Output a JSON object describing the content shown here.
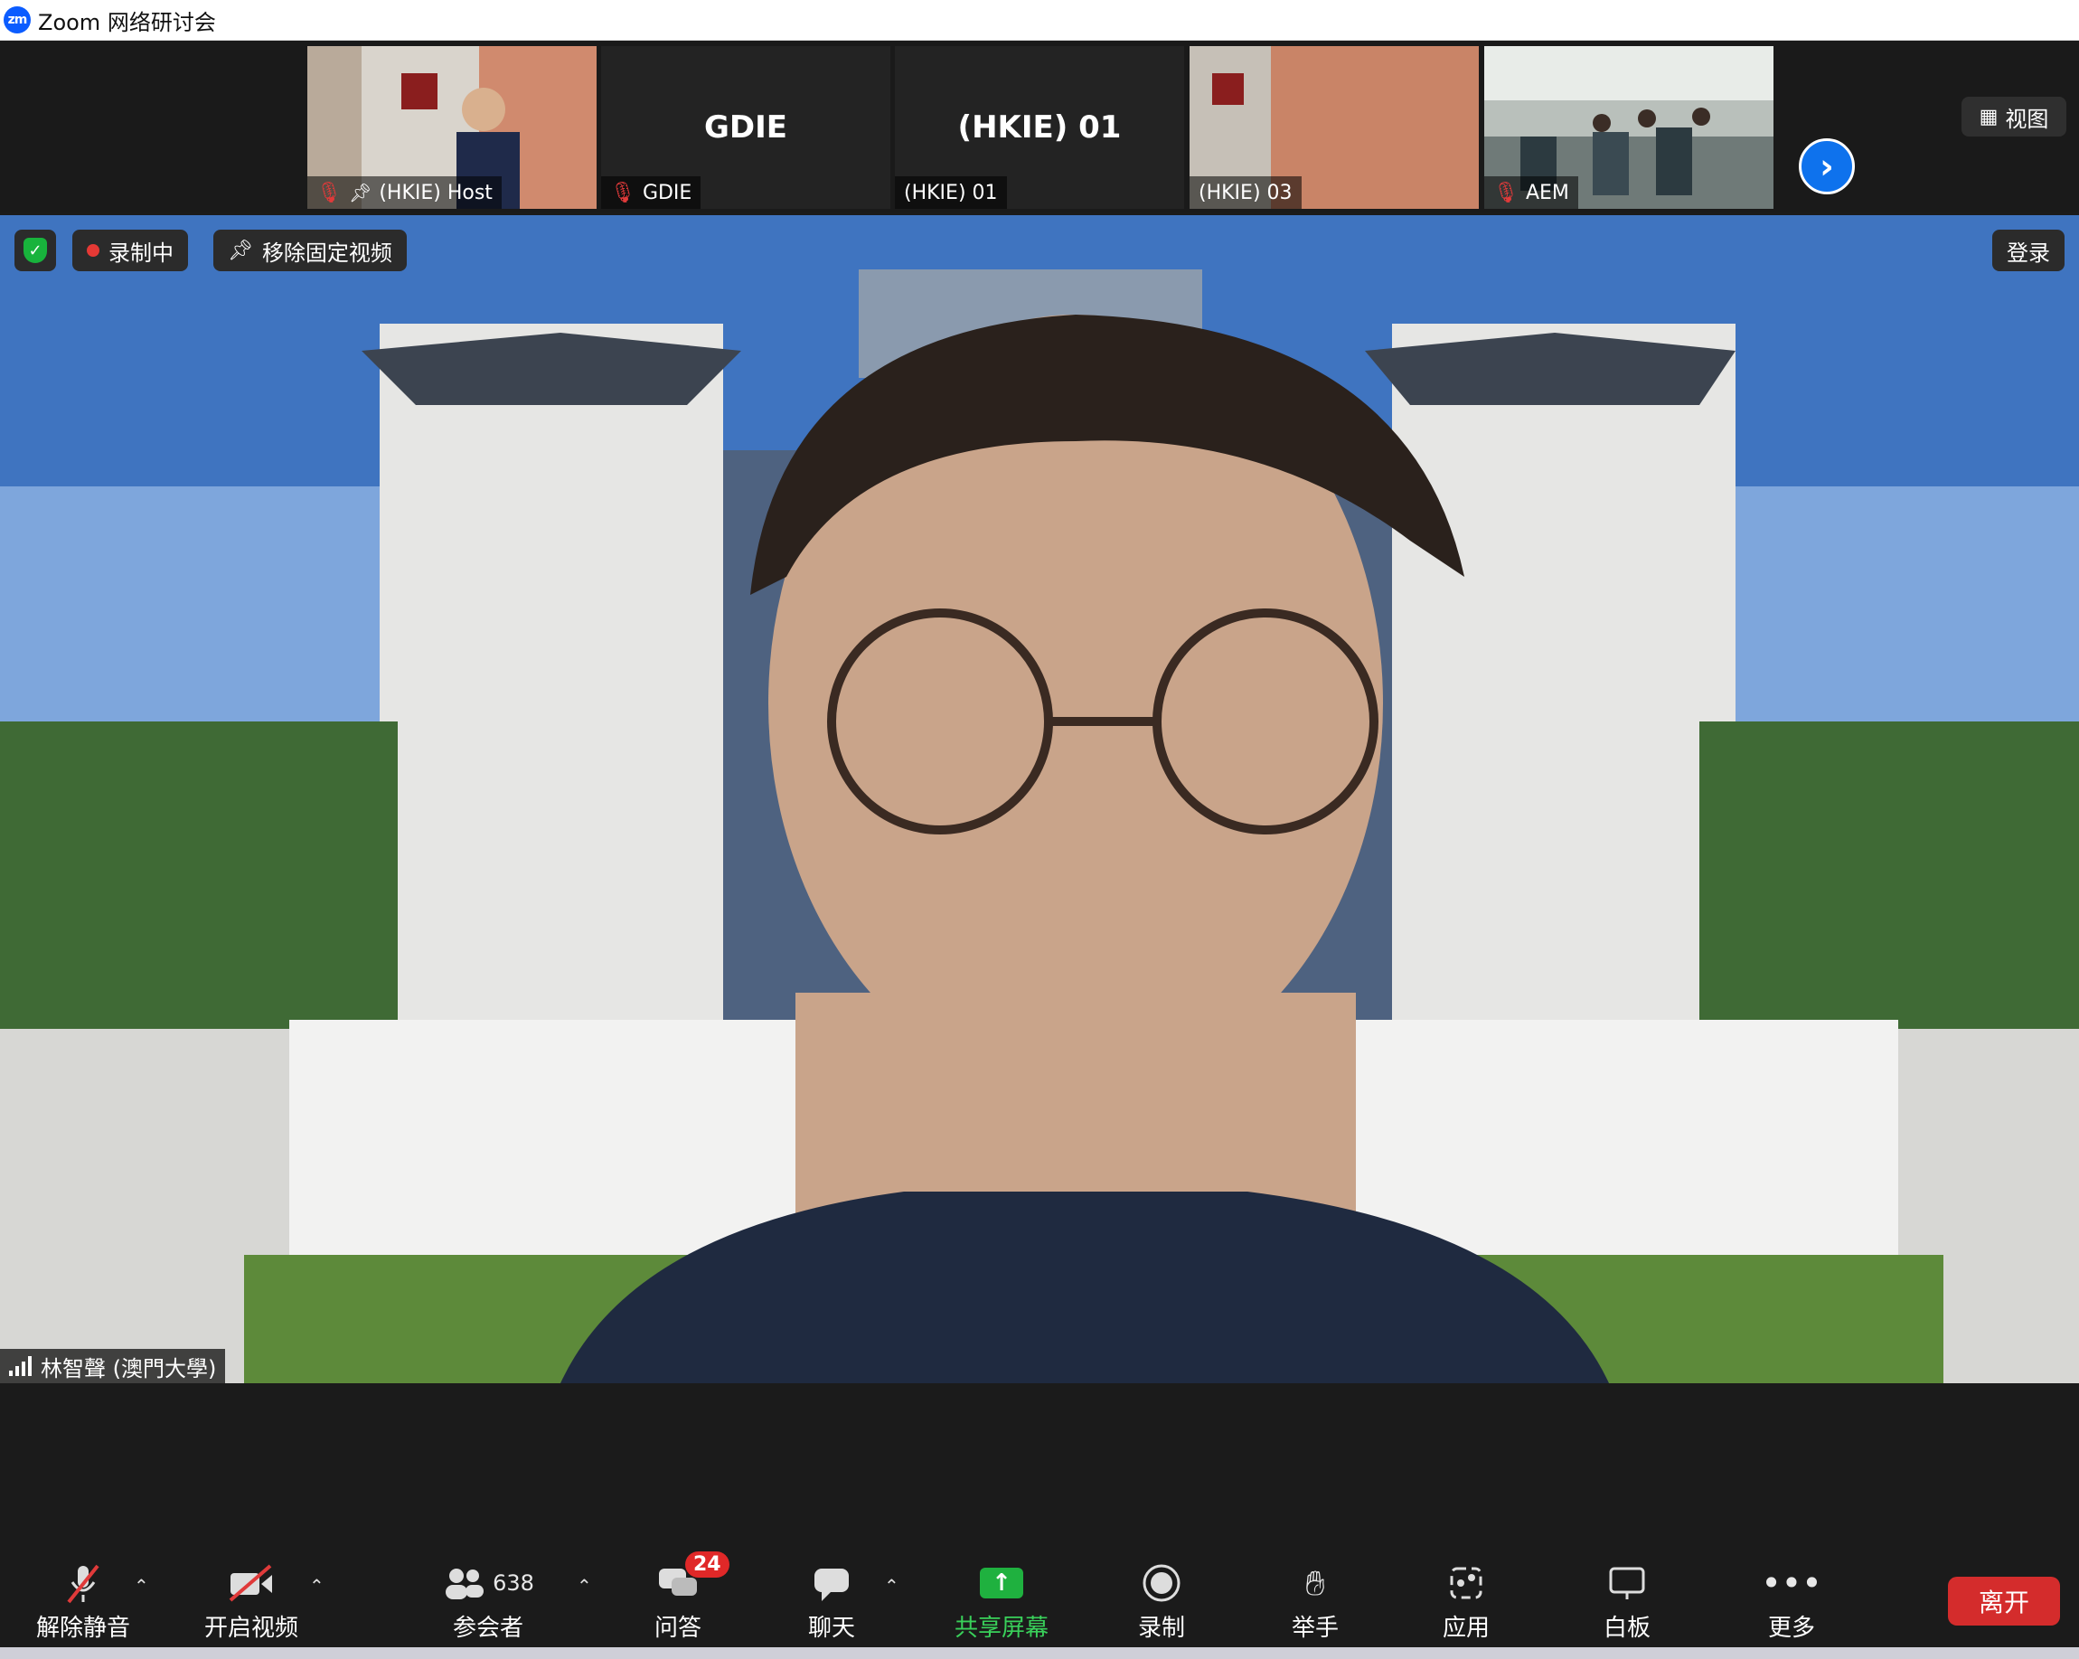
{
  "window": {
    "title": "Zoom 网络研讨会",
    "logo_text": "zm"
  },
  "gallery": {
    "tiles": [
      {
        "name": "(HKIE) Host",
        "big_name": "",
        "muted": true,
        "pinned": true
      },
      {
        "name": "GDIE",
        "big_name": "GDIE",
        "muted": true,
        "pinned": false
      },
      {
        "name": "(HKIE) 01",
        "big_name": "(HKIE) 01",
        "muted": false,
        "pinned": false
      },
      {
        "name": "(HKIE) 03",
        "big_name": "",
        "muted": false,
        "pinned": false
      },
      {
        "name": "AEM",
        "big_name": "",
        "muted": true,
        "pinned": false
      }
    ],
    "view_label": "视图"
  },
  "main": {
    "recording_label": "录制中",
    "unpin_label": "移除固定视频",
    "login_label": "登录",
    "speaker_name": "林智聲 (澳門大學)"
  },
  "toolbar": {
    "unmute": "解除静音",
    "start_video": "开启视频",
    "participants": "参会者",
    "participants_count": "638",
    "qa": "问答",
    "qa_badge": "24",
    "chat": "聊天",
    "share": "共享屏幕",
    "record": "录制",
    "raise_hand": "举手",
    "apps": "应用",
    "whiteboard": "白板",
    "more": "更多",
    "leave": "离开"
  },
  "colors": {
    "accent": "#0e72ed",
    "leave": "#d42c2c",
    "share": "#1fb13f",
    "record_dot": "#e53935"
  }
}
